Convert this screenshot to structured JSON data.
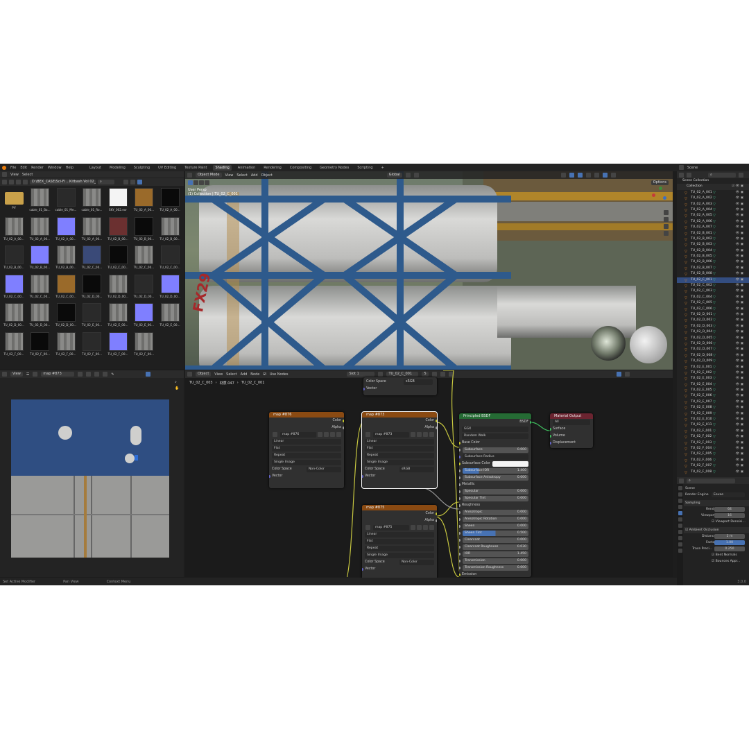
{
  "menu": {
    "items": [
      "File",
      "Edit",
      "Render",
      "Window",
      "Help"
    ],
    "workspaces": [
      "Layout",
      "Modeling",
      "Sculpting",
      "UV Editing",
      "Texture Paint",
      "Shading",
      "Animation",
      "Rendering",
      "Compositing",
      "Geometry Nodes",
      "Scripting",
      "+"
    ],
    "active_workspace": "Shading",
    "scene": "Scene",
    "view_layer": "ViewLayer"
  },
  "file_browser": {
    "view": "View",
    "select": "Select",
    "path": "D:\\BEX_CASE\\Sci-Fi ...Kitbash Vol 02_v2.0\\",
    "items": [
      {
        "label": "PV",
        "tex": "folder"
      },
      {
        "label": "cable_01_Ba...",
        "tex": "gray"
      },
      {
        "label": "cable_01_Me...",
        "tex": "dark"
      },
      {
        "label": "cable_01_Ro...",
        "tex": "gray"
      },
      {
        "label": "SKY_002.exr",
        "tex": "white"
      },
      {
        "label": "TU_02_A_00...",
        "tex": "orange"
      },
      {
        "label": "TU_02_A_00...",
        "tex": "black"
      },
      {
        "label": "TU_02_A_00...",
        "tex": "gray"
      },
      {
        "label": "TU_02_A_00...",
        "tex": "gray"
      },
      {
        "label": "TU_02_A_00...",
        "tex": "normal"
      },
      {
        "label": "TU_02_A_00...",
        "tex": "gray"
      },
      {
        "label": "TU_02_B_00...",
        "tex": "red"
      },
      {
        "label": "TU_02_B_00...",
        "tex": "black"
      },
      {
        "label": "TU_02_B_00...",
        "tex": "gray"
      },
      {
        "label": "TU_02_B_00...",
        "tex": "dark"
      },
      {
        "label": "TU_02_B_00...",
        "tex": "normal"
      },
      {
        "label": "TU_02_B_00...",
        "tex": "gray"
      },
      {
        "label": "TU_02_C_00...",
        "tex": "blue"
      },
      {
        "label": "TU_02_C_00...",
        "tex": "black"
      },
      {
        "label": "TU_02_C_00...",
        "tex": "gray"
      },
      {
        "label": "TU_02_C_00...",
        "tex": "dark"
      },
      {
        "label": "TU_02_C_00...",
        "tex": "normal"
      },
      {
        "label": "TU_02_C_00...",
        "tex": "gray"
      },
      {
        "label": "TU_02_C_00...",
        "tex": "orange"
      },
      {
        "label": "TU_02_D_00...",
        "tex": "black"
      },
      {
        "label": "TU_02_D_00...",
        "tex": "gray"
      },
      {
        "label": "TU_02_D_00...",
        "tex": "dark"
      },
      {
        "label": "TU_02_D_00...",
        "tex": "normal"
      },
      {
        "label": "TU_02_D_00...",
        "tex": "gray"
      },
      {
        "label": "TU_02_D_00...",
        "tex": "gray"
      },
      {
        "label": "TU_02_D_00...",
        "tex": "black"
      },
      {
        "label": "TU_02_E_00...",
        "tex": "dark"
      },
      {
        "label": "TU_02_E_00...",
        "tex": "gray"
      },
      {
        "label": "TU_02_E_00...",
        "tex": "normal"
      },
      {
        "label": "TU_02_E_00...",
        "tex": "gray"
      },
      {
        "label": "TU_02_F_00...",
        "tex": "gray"
      },
      {
        "label": "TU_02_F_00...",
        "tex": "black"
      },
      {
        "label": "TU_02_F_00...",
        "tex": "gray"
      },
      {
        "label": "TU_02_F_00...",
        "tex": "dark"
      },
      {
        "label": "TU_02_F_00...",
        "tex": "normal"
      },
      {
        "label": "TU_02_F_00...",
        "tex": "gray"
      }
    ]
  },
  "viewport": {
    "mode": "Object Mode",
    "menus": [
      "View",
      "Select",
      "Add",
      "Object"
    ],
    "orientation": "Global",
    "options": "Options",
    "overlay_line1": "User Persp",
    "overlay_line2": "(1) Collection | TU_02_C_001",
    "decal_text": "FX29"
  },
  "image_editor": {
    "view": "View",
    "image": "map #873"
  },
  "node_editor": {
    "mode": "Object",
    "menus": [
      "View",
      "Select",
      "Add",
      "Node"
    ],
    "use_nodes": "Use Nodes",
    "slot": "Slot 1",
    "material": "TU_02_C_001",
    "users": "5",
    "breadcrumb": [
      "TU_02_C_003",
      "材质.047",
      "TU_02_C_001"
    ],
    "top_node": {
      "color_space_label": "Color Space",
      "color_space": "sRGB",
      "vector": "Vector"
    },
    "tex_nodes": [
      {
        "title": "map #876",
        "image": "map #876",
        "interp": "Linear",
        "proj": "Flat",
        "ext": "Repeat",
        "src": "Single Image",
        "cs_label": "Color Space",
        "cs": "Non-Color",
        "out_color": "Color",
        "out_alpha": "Alpha",
        "vector": "Vector"
      },
      {
        "title": "map #873",
        "image": "map #873",
        "interp": "Linear",
        "proj": "Flat",
        "ext": "Repeat",
        "src": "Single Image",
        "cs_label": "Color Space",
        "cs": "sRGB",
        "out_color": "Color",
        "out_alpha": "Alpha",
        "vector": "Vector"
      },
      {
        "title": "map #875",
        "image": "map #875",
        "interp": "Linear",
        "proj": "Flat",
        "ext": "Repeat",
        "src": "Single Image",
        "cs_label": "Color Space",
        "cs": "Non-Color",
        "out_color": "Color",
        "out_alpha": "Alpha",
        "vector": "Vector"
      }
    ],
    "bsdf": {
      "title": "Principled BSDF",
      "output": "BSDF",
      "distribution": "GGX",
      "subsurface_method": "Random Walk",
      "rows": [
        {
          "label": "Base Color",
          "type": "socket"
        },
        {
          "label": "Subsurface",
          "type": "field",
          "value": "0.000"
        },
        {
          "label": "Subsurface Radius",
          "type": "dd"
        },
        {
          "label": "Subsurface Color",
          "type": "color"
        },
        {
          "label": "Subsurface IOR",
          "type": "field",
          "value": "1.400",
          "fill": 0.25
        },
        {
          "label": "Subsurface Anisotropy",
          "type": "field",
          "value": "0.000"
        },
        {
          "label": "Metallic",
          "type": "socket"
        },
        {
          "label": "Specular",
          "type": "field",
          "value": "0.000"
        },
        {
          "label": "Specular Tint",
          "type": "field",
          "value": "0.000"
        },
        {
          "label": "Roughness",
          "type": "socket"
        },
        {
          "label": "Anisotropic",
          "type": "field",
          "value": "0.000"
        },
        {
          "label": "Anisotropic Rotation",
          "type": "field",
          "value": "0.000"
        },
        {
          "label": "Sheen",
          "type": "field",
          "value": "0.000"
        },
        {
          "label": "Sheen Tint",
          "type": "field",
          "value": "0.500",
          "fill": 0.5
        },
        {
          "label": "Clearcoat",
          "type": "field",
          "value": "0.000"
        },
        {
          "label": "Clearcoat Roughness",
          "type": "field",
          "value": "0.030"
        },
        {
          "label": "IOR",
          "type": "field",
          "value": "1.450"
        },
        {
          "label": "Transmission",
          "type": "field",
          "value": "0.000"
        },
        {
          "label": "Transmission Roughness",
          "type": "field",
          "value": "0.000"
        },
        {
          "label": "Emission",
          "type": "socket"
        }
      ]
    },
    "mat_out": {
      "title": "Material Output",
      "target": "All",
      "inputs": [
        "Surface",
        "Volume",
        "Displacement"
      ]
    }
  },
  "outliner": {
    "root": "Scene Collection",
    "collection": "Collection",
    "objects": [
      "TU_02_A_001",
      "TU_02_A_002",
      "TU_02_A_003",
      "TU_02_A_004",
      "TU_02_A_005",
      "TU_02_A_006",
      "TU_02_A_007",
      "TU_02_B_001",
      "TU_02_B_002",
      "TU_02_B_003",
      "TU_02_B_004",
      "TU_02_B_005",
      "TU_02_B_006",
      "TU_02_B_007",
      "TU_02_B_008",
      "TU_02_C_001",
      "TU_02_C_002",
      "TU_02_C_003",
      "TU_02_C_004",
      "TU_02_C_005",
      "TU_02_C_006",
      "TU_02_D_001",
      "TU_02_D_002",
      "TU_02_D_003",
      "TU_02_D_004",
      "TU_02_D_005",
      "TU_02_D_006",
      "TU_02_D_007",
      "TU_02_D_008",
      "TU_02_D_009",
      "TU_02_E_001",
      "TU_02_E_002",
      "TU_02_E_003",
      "TU_02_E_004",
      "TU_02_E_005",
      "TU_02_E_006",
      "TU_02_E_007",
      "TU_02_E_008",
      "TU_02_E_009",
      "TU_02_E_010",
      "TU_02_E_011",
      "TU_02_F_001",
      "TU_02_F_002",
      "TU_02_F_003",
      "TU_02_F_004",
      "TU_02_F_005",
      "TU_02_F_006",
      "TU_02_F_007",
      "TU_02_F_008"
    ]
  },
  "properties": {
    "context": "Scene",
    "render_engine_label": "Render Engine",
    "render_engine": "Eevee",
    "sampling": "Sampling",
    "render_label": "Render",
    "render": "64",
    "viewport_label": "Viewport",
    "viewport": "16",
    "denoise": "Viewport Denoisi...",
    "ao": "Ambient Occlusion",
    "distance_label": "Distance",
    "distance": "2 m",
    "factor_label": "Factor",
    "factor": "1.00",
    "trace_label": "Trace Preci...",
    "trace": "0.250",
    "bent": "Bent Normals",
    "bounces": "Bounces Appr..."
  },
  "statusbar": {
    "items": [
      "Set Active Modifier",
      "Pan View",
      "Context Menu"
    ],
    "version": "3.0.0"
  }
}
